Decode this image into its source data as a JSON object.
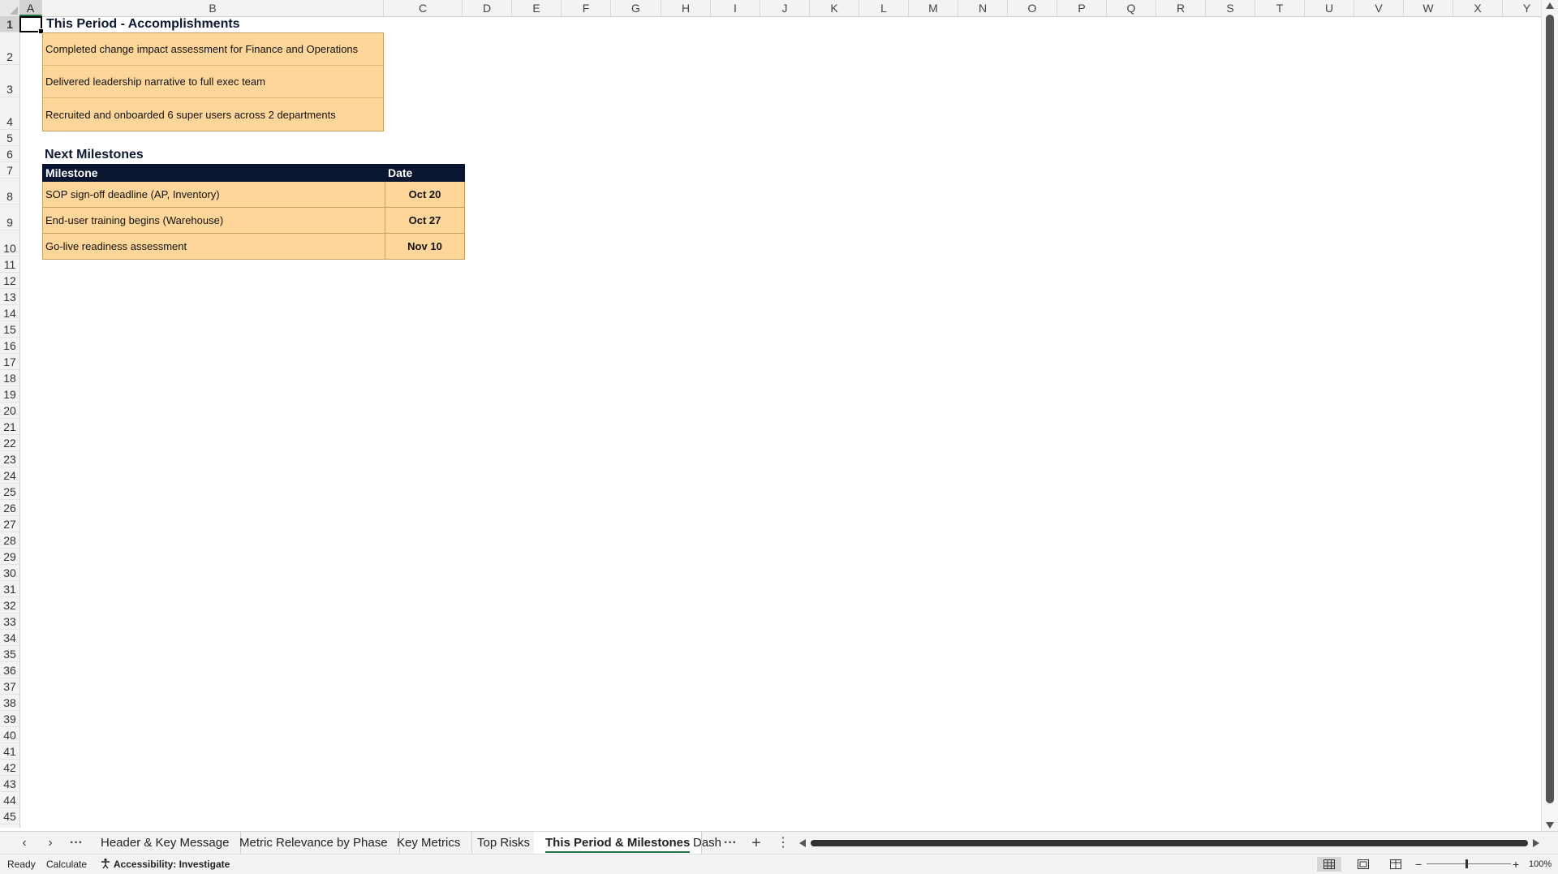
{
  "columns": [
    "A",
    "B",
    "C",
    "D",
    "E",
    "F",
    "G",
    "H",
    "I",
    "J",
    "K",
    "L",
    "M",
    "N",
    "O",
    "P",
    "Q",
    "R",
    "S",
    "T",
    "U",
    "V",
    "W",
    "X",
    "Y"
  ],
  "rows": [
    "1",
    "2",
    "3",
    "4",
    "5",
    "6",
    "7",
    "8",
    "9",
    "10",
    "11",
    "12",
    "13",
    "14",
    "15",
    "16",
    "17",
    "18",
    "19",
    "20",
    "21",
    "22",
    "23",
    "24",
    "25",
    "26",
    "27",
    "28",
    "29",
    "30",
    "31",
    "32",
    "33",
    "34",
    "35",
    "36",
    "37",
    "38",
    "39",
    "40",
    "41",
    "42",
    "43",
    "44",
    "45"
  ],
  "accomplishments": {
    "title": "This Period - Accomplishments",
    "items": [
      "Completed change impact assessment for Finance and Operations",
      "Delivered leadership narrative to full exec team",
      "Recruited and onboarded 6 super users across 2 departments"
    ]
  },
  "milestones": {
    "title": "Next Milestones",
    "headers": {
      "milestone": "Milestone",
      "date": "Date"
    },
    "rows": [
      {
        "milestone": "SOP sign-off deadline (AP, Inventory)",
        "date": "Oct 20"
      },
      {
        "milestone": "End-user training begins (Warehouse)",
        "date": "Oct 27"
      },
      {
        "milestone": "Go-live readiness assessment",
        "date": "Nov 10"
      }
    ]
  },
  "tabs": {
    "more": "···",
    "items": [
      "Header & Key Message",
      "Metric Relevance by Phase",
      "Key Metrics",
      "Top Risks",
      "This Period & Milestones",
      "Dash"
    ],
    "active_index": 4,
    "overflow": "···",
    "add": "+",
    "options": "⋮"
  },
  "status": {
    "ready": "Ready",
    "calculate": "Calculate",
    "accessibility": "Accessibility: Investigate",
    "zoom_minus": "−",
    "zoom_plus": "+",
    "zoom": "100%"
  }
}
